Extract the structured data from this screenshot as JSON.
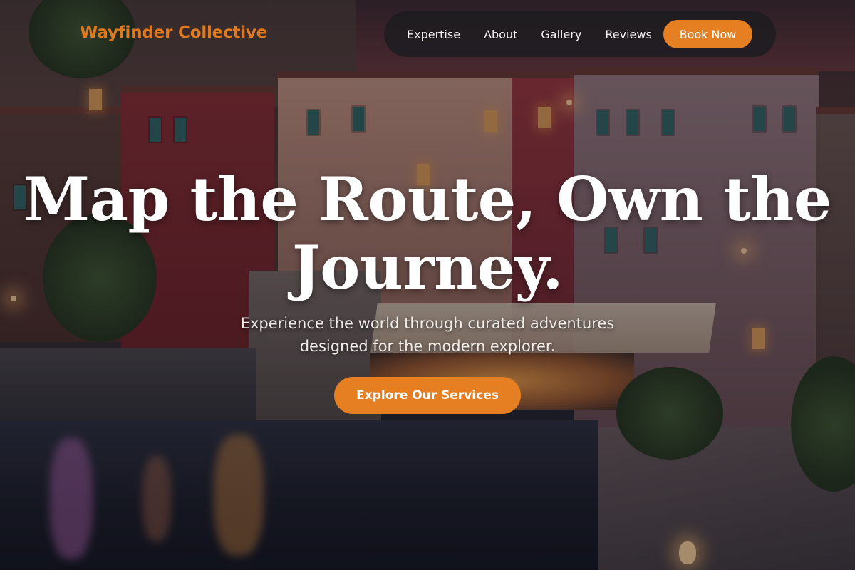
{
  "header": {
    "brand": "Wayfinder Collective",
    "nav": [
      {
        "label": "Expertise"
      },
      {
        "label": "About"
      },
      {
        "label": "Gallery"
      },
      {
        "label": "Reviews"
      }
    ],
    "book_label": "Book Now"
  },
  "hero": {
    "title": "Map the Route, Own the Journey.",
    "subtitle": "Experience the world through curated adventures designed for the modern explorer.",
    "cta_label": "Explore Our Services",
    "background_image": "lakeside-village-at-dusk"
  },
  "colors": {
    "accent": "#e67e22",
    "brand_text": "#e07a1f",
    "nav_bg": "#1c1c20"
  }
}
